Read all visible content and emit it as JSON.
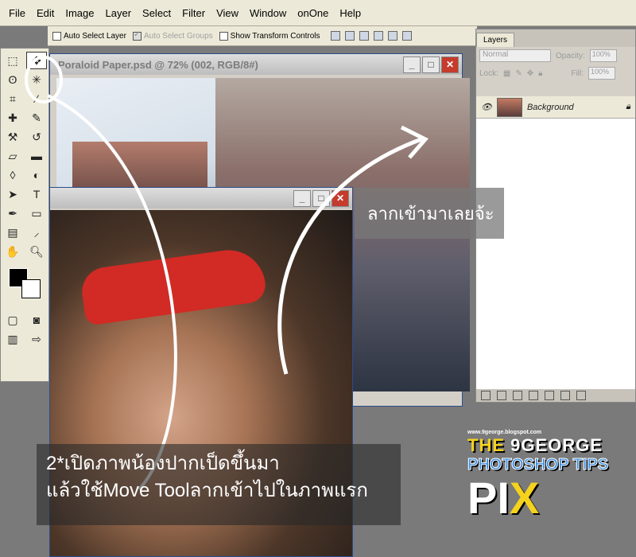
{
  "menu": [
    "File",
    "Edit",
    "Image",
    "Layer",
    "Select",
    "Filter",
    "View",
    "Window",
    "onOne",
    "Help"
  ],
  "options": {
    "auto_select_layer": "Auto Select Layer",
    "auto_select_groups": "Auto Select Groups",
    "show_transform_controls": "Show Transform Controls"
  },
  "doc1": {
    "title": "Poraloid Paper.psd @ 72% (002, RGB/8#)"
  },
  "layers": {
    "tab": "Layers",
    "blend_mode": "Normal",
    "opacity_label": "Opacity:",
    "opacity_value": "100%",
    "lock_label": "Lock:",
    "fill_label": "Fill:",
    "fill_value": "100%",
    "layer_name": "Background"
  },
  "annotations": {
    "drag_note": "ลากเข้ามาเลยจ้ะ",
    "step_line1": "2*เปิดภาพน้องปากเป็ดขึ้นมา",
    "step_line2": "แล้วใช้Move Toolลากเข้าไปในภาพแรก"
  },
  "logo": {
    "the": "THE",
    "brand": "9GEORGE",
    "subtitle": "PHOTOSHOP TIPS",
    "pi": "PI",
    "x": "X",
    "url": "www.9george.blogspot.com"
  },
  "colors": {
    "close_button": "#c53b2c",
    "headband": "#d22a24",
    "logo_yellow": "#f4d21e",
    "logo_blue": "#3b8de0"
  }
}
